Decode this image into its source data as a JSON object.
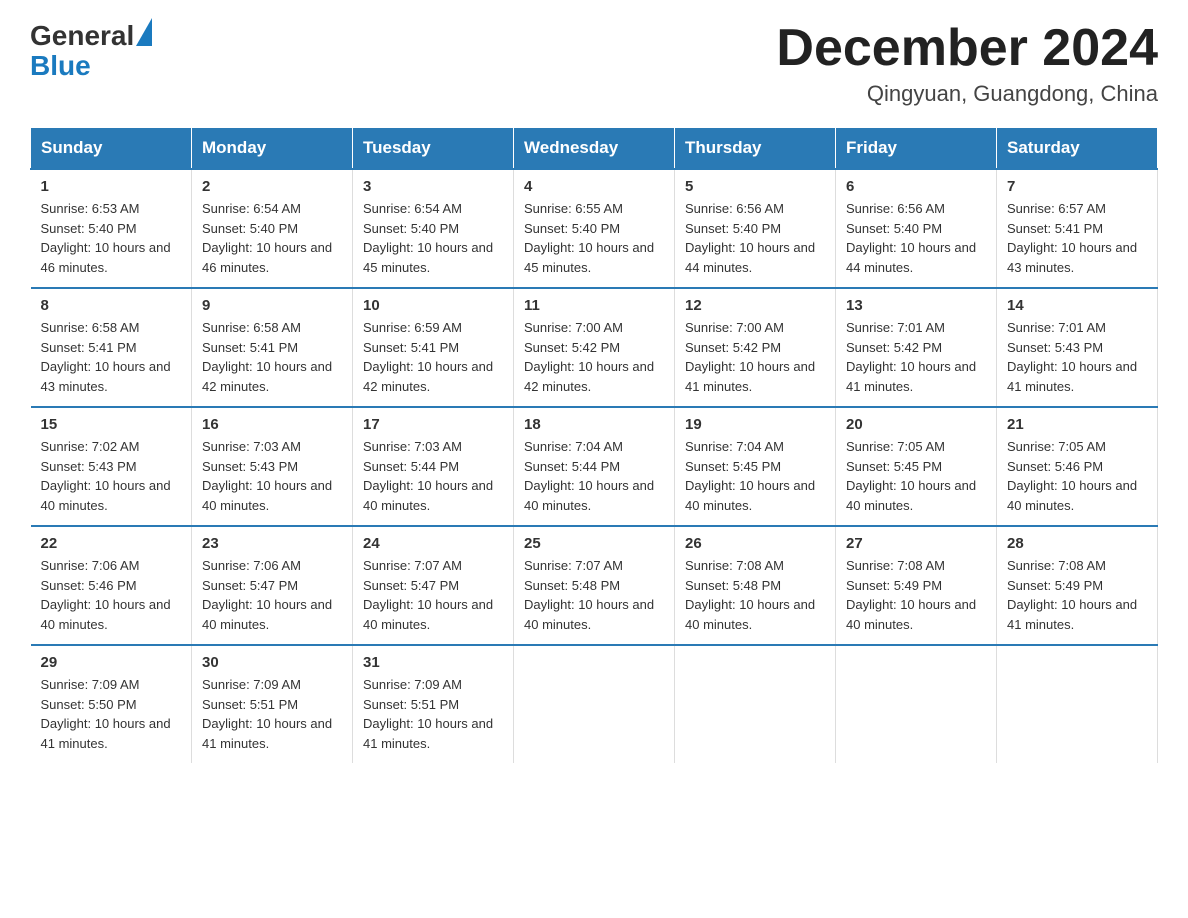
{
  "header": {
    "logo_general": "General",
    "logo_blue": "Blue",
    "month_title": "December 2024",
    "location": "Qingyuan, Guangdong, China"
  },
  "days_of_week": [
    "Sunday",
    "Monday",
    "Tuesday",
    "Wednesday",
    "Thursday",
    "Friday",
    "Saturday"
  ],
  "weeks": [
    [
      {
        "day": "1",
        "sunrise": "6:53 AM",
        "sunset": "5:40 PM",
        "daylight": "10 hours and 46 minutes."
      },
      {
        "day": "2",
        "sunrise": "6:54 AM",
        "sunset": "5:40 PM",
        "daylight": "10 hours and 46 minutes."
      },
      {
        "day": "3",
        "sunrise": "6:54 AM",
        "sunset": "5:40 PM",
        "daylight": "10 hours and 45 minutes."
      },
      {
        "day": "4",
        "sunrise": "6:55 AM",
        "sunset": "5:40 PM",
        "daylight": "10 hours and 45 minutes."
      },
      {
        "day": "5",
        "sunrise": "6:56 AM",
        "sunset": "5:40 PM",
        "daylight": "10 hours and 44 minutes."
      },
      {
        "day": "6",
        "sunrise": "6:56 AM",
        "sunset": "5:40 PM",
        "daylight": "10 hours and 44 minutes."
      },
      {
        "day": "7",
        "sunrise": "6:57 AM",
        "sunset": "5:41 PM",
        "daylight": "10 hours and 43 minutes."
      }
    ],
    [
      {
        "day": "8",
        "sunrise": "6:58 AM",
        "sunset": "5:41 PM",
        "daylight": "10 hours and 43 minutes."
      },
      {
        "day": "9",
        "sunrise": "6:58 AM",
        "sunset": "5:41 PM",
        "daylight": "10 hours and 42 minutes."
      },
      {
        "day": "10",
        "sunrise": "6:59 AM",
        "sunset": "5:41 PM",
        "daylight": "10 hours and 42 minutes."
      },
      {
        "day": "11",
        "sunrise": "7:00 AM",
        "sunset": "5:42 PM",
        "daylight": "10 hours and 42 minutes."
      },
      {
        "day": "12",
        "sunrise": "7:00 AM",
        "sunset": "5:42 PM",
        "daylight": "10 hours and 41 minutes."
      },
      {
        "day": "13",
        "sunrise": "7:01 AM",
        "sunset": "5:42 PM",
        "daylight": "10 hours and 41 minutes."
      },
      {
        "day": "14",
        "sunrise": "7:01 AM",
        "sunset": "5:43 PM",
        "daylight": "10 hours and 41 minutes."
      }
    ],
    [
      {
        "day": "15",
        "sunrise": "7:02 AM",
        "sunset": "5:43 PM",
        "daylight": "10 hours and 40 minutes."
      },
      {
        "day": "16",
        "sunrise": "7:03 AM",
        "sunset": "5:43 PM",
        "daylight": "10 hours and 40 minutes."
      },
      {
        "day": "17",
        "sunrise": "7:03 AM",
        "sunset": "5:44 PM",
        "daylight": "10 hours and 40 minutes."
      },
      {
        "day": "18",
        "sunrise": "7:04 AM",
        "sunset": "5:44 PM",
        "daylight": "10 hours and 40 minutes."
      },
      {
        "day": "19",
        "sunrise": "7:04 AM",
        "sunset": "5:45 PM",
        "daylight": "10 hours and 40 minutes."
      },
      {
        "day": "20",
        "sunrise": "7:05 AM",
        "sunset": "5:45 PM",
        "daylight": "10 hours and 40 minutes."
      },
      {
        "day": "21",
        "sunrise": "7:05 AM",
        "sunset": "5:46 PM",
        "daylight": "10 hours and 40 minutes."
      }
    ],
    [
      {
        "day": "22",
        "sunrise": "7:06 AM",
        "sunset": "5:46 PM",
        "daylight": "10 hours and 40 minutes."
      },
      {
        "day": "23",
        "sunrise": "7:06 AM",
        "sunset": "5:47 PM",
        "daylight": "10 hours and 40 minutes."
      },
      {
        "day": "24",
        "sunrise": "7:07 AM",
        "sunset": "5:47 PM",
        "daylight": "10 hours and 40 minutes."
      },
      {
        "day": "25",
        "sunrise": "7:07 AM",
        "sunset": "5:48 PM",
        "daylight": "10 hours and 40 minutes."
      },
      {
        "day": "26",
        "sunrise": "7:08 AM",
        "sunset": "5:48 PM",
        "daylight": "10 hours and 40 minutes."
      },
      {
        "day": "27",
        "sunrise": "7:08 AM",
        "sunset": "5:49 PM",
        "daylight": "10 hours and 40 minutes."
      },
      {
        "day": "28",
        "sunrise": "7:08 AM",
        "sunset": "5:49 PM",
        "daylight": "10 hours and 41 minutes."
      }
    ],
    [
      {
        "day": "29",
        "sunrise": "7:09 AM",
        "sunset": "5:50 PM",
        "daylight": "10 hours and 41 minutes."
      },
      {
        "day": "30",
        "sunrise": "7:09 AM",
        "sunset": "5:51 PM",
        "daylight": "10 hours and 41 minutes."
      },
      {
        "day": "31",
        "sunrise": "7:09 AM",
        "sunset": "5:51 PM",
        "daylight": "10 hours and 41 minutes."
      },
      null,
      null,
      null,
      null
    ]
  ],
  "labels": {
    "sunrise": "Sunrise:",
    "sunset": "Sunset:",
    "daylight": "Daylight:"
  }
}
